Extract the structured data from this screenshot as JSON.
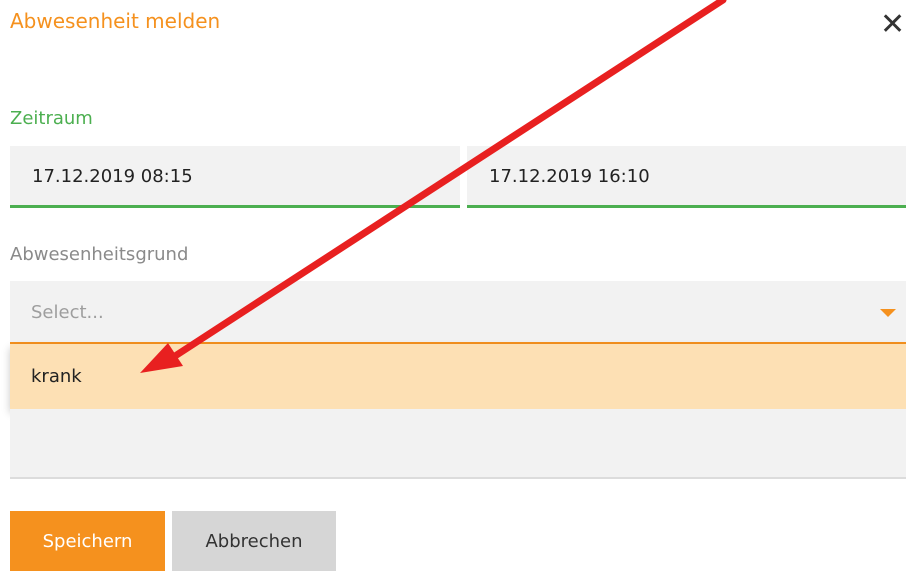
{
  "dialog": {
    "title": "Abwesenheit melden",
    "close_label": "✕"
  },
  "period": {
    "label": "Zeitraum",
    "from": "17.12.2019 08:15",
    "to": "17.12.2019 16:10"
  },
  "reason": {
    "label": "Abwesenheitsgrund",
    "placeholder": "Select...",
    "options": [
      "krank"
    ]
  },
  "buttons": {
    "save": "Speichern",
    "cancel": "Abbrechen"
  },
  "colors": {
    "accent": "#f5911e",
    "success": "#4caf50",
    "highlight": "#fde0b4",
    "annotation_arrow": "#e82020"
  }
}
